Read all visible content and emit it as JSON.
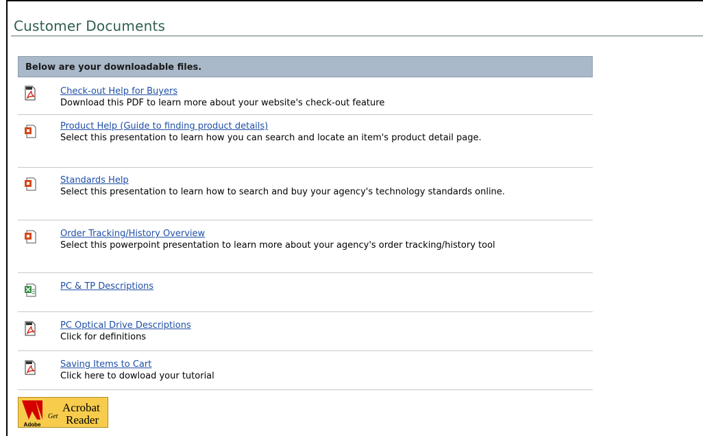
{
  "page": {
    "title": "Customer Documents"
  },
  "panel": {
    "header": "Below are your downloadable files."
  },
  "documents": [
    {
      "icon": "pdf-icon",
      "link": "Check-out Help for Buyers",
      "description": "Download this PDF to learn more about your website's check-out feature"
    },
    {
      "icon": "powerpoint-icon",
      "link": "Product Help (Guide to finding product details)",
      "description": "Select this presentation to learn how you can search and locate an item's product detail page."
    },
    {
      "icon": "powerpoint-icon",
      "link": "Standards Help",
      "description": "Select this presentation to learn how to search and buy your agency's technology standards online."
    },
    {
      "icon": "powerpoint-icon",
      "link": "Order Tracking/History Overview",
      "description": "Select this powerpoint presentation to learn more about your agency's order tracking/history tool"
    },
    {
      "icon": "excel-icon",
      "link": "PC & TP Descriptions",
      "description": ""
    },
    {
      "icon": "pdf-icon",
      "link": "PC Optical Drive Descriptions",
      "description": "Click for definitions"
    },
    {
      "icon": "pdf-icon",
      "link": "Saving Items to Cart",
      "description": "Click here to dowload your tutorial"
    }
  ],
  "acrobat": {
    "brand": "Adobe",
    "get": "Get",
    "line1": "Acrobat",
    "line2": "Reader"
  },
  "colors": {
    "title": "#2f5f4f",
    "header_bg": "#a9b9c9",
    "link": "#1f4fa6",
    "pdf": "#d42a1a",
    "ppt": "#d4481a",
    "xls": "#2d8a3a"
  }
}
